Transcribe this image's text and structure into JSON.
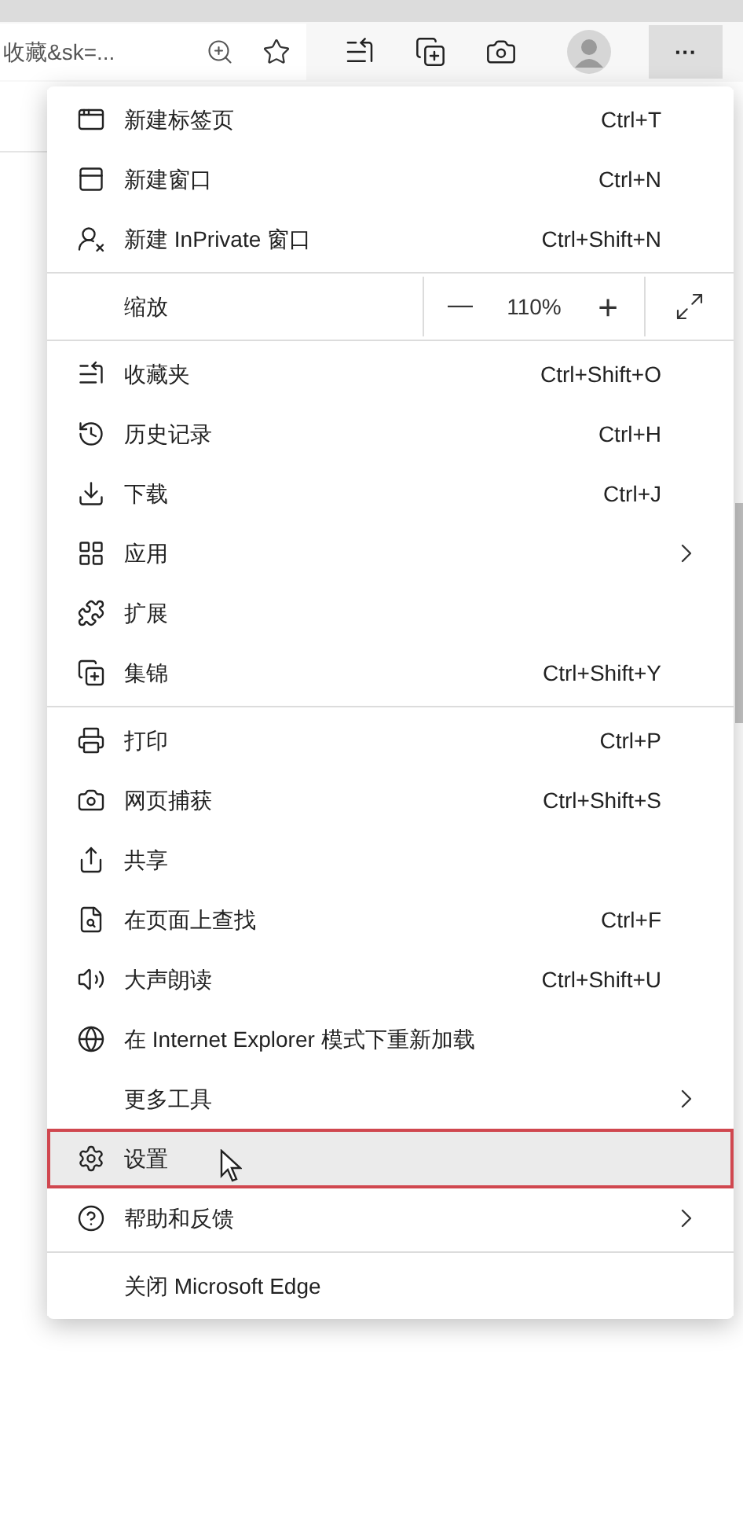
{
  "address_bar": {
    "text": "收藏&sk=..."
  },
  "more_button": {
    "label": "···",
    "selected": true
  },
  "menu": {
    "items": [
      {
        "kind": "item",
        "label": "新建标签页",
        "shortcut": "Ctrl+T",
        "submenu": false,
        "hovered": false,
        "highlighted": false
      },
      {
        "kind": "item",
        "label": "新建窗口",
        "shortcut": "Ctrl+N",
        "submenu": false,
        "hovered": false,
        "highlighted": false
      },
      {
        "kind": "item",
        "label": "新建 InPrivate 窗口",
        "shortcut": "Ctrl+Shift+N",
        "submenu": false,
        "hovered": false,
        "highlighted": false
      },
      {
        "kind": "separator"
      },
      {
        "kind": "zoom",
        "label": "缩放",
        "minus": "—",
        "value": "110%",
        "plus": "+"
      },
      {
        "kind": "separator"
      },
      {
        "kind": "item",
        "label": "收藏夹",
        "shortcut": "Ctrl+Shift+O",
        "submenu": false,
        "hovered": false,
        "highlighted": false
      },
      {
        "kind": "item",
        "label": "历史记录",
        "shortcut": "Ctrl+H",
        "submenu": false,
        "hovered": false,
        "highlighted": false
      },
      {
        "kind": "item",
        "label": "下载",
        "shortcut": "Ctrl+J",
        "submenu": false,
        "hovered": false,
        "highlighted": false
      },
      {
        "kind": "item",
        "label": "应用",
        "submenu": true,
        "hovered": false,
        "highlighted": false
      },
      {
        "kind": "item",
        "label": "扩展",
        "submenu": false,
        "hovered": false,
        "highlighted": false
      },
      {
        "kind": "item",
        "label": "集锦",
        "shortcut": "Ctrl+Shift+Y",
        "submenu": false,
        "hovered": false,
        "highlighted": false
      },
      {
        "kind": "separator"
      },
      {
        "kind": "item",
        "label": "打印",
        "shortcut": "Ctrl+P",
        "submenu": false,
        "hovered": false,
        "highlighted": false
      },
      {
        "kind": "item",
        "label": "网页捕获",
        "shortcut": "Ctrl+Shift+S",
        "submenu": false,
        "hovered": false,
        "highlighted": false
      },
      {
        "kind": "item",
        "label": "共享",
        "submenu": false,
        "hovered": false,
        "highlighted": false
      },
      {
        "kind": "item",
        "label": "在页面上查找",
        "shortcut": "Ctrl+F",
        "submenu": false,
        "hovered": false,
        "highlighted": false
      },
      {
        "kind": "item",
        "label": "大声朗读",
        "shortcut": "Ctrl+Shift+U",
        "submenu": false,
        "hovered": false,
        "highlighted": false
      },
      {
        "kind": "item",
        "label": "在 Internet Explorer 模式下重新加载",
        "submenu": false,
        "hovered": false,
        "highlighted": false
      },
      {
        "kind": "item",
        "label": "更多工具",
        "submenu": true,
        "hovered": false,
        "highlighted": false
      },
      {
        "kind": "item",
        "label": "设置",
        "submenu": false,
        "hovered": true,
        "highlighted": true
      },
      {
        "kind": "item",
        "label": "帮助和反馈",
        "submenu": true,
        "hovered": false,
        "highlighted": false
      },
      {
        "kind": "separator"
      },
      {
        "kind": "item",
        "label": "关闭 Microsoft Edge",
        "submenu": false,
        "hovered": false,
        "highlighted": false
      }
    ]
  }
}
